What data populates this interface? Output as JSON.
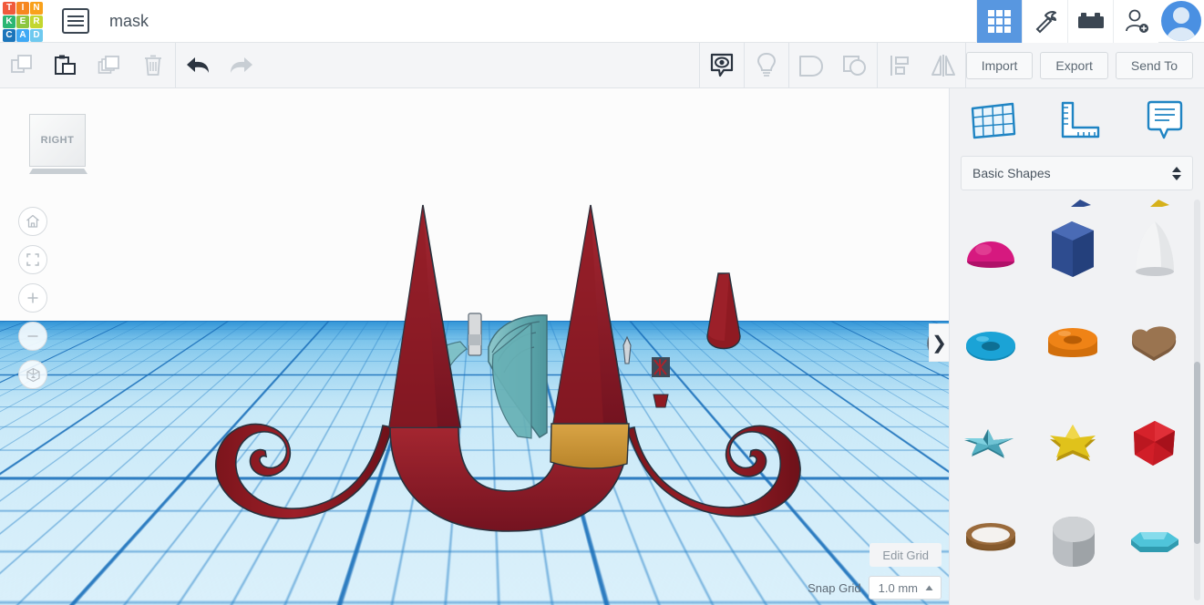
{
  "app": {
    "name": "Tinkercad",
    "logo_tiles": [
      {
        "letter": "T",
        "color": "#f05a3c"
      },
      {
        "letter": "I",
        "color": "#f6871f"
      },
      {
        "letter": "N",
        "color": "#f9a11b"
      },
      {
        "letter": "K",
        "color": "#2bb673"
      },
      {
        "letter": "E",
        "color": "#8dc63f"
      },
      {
        "letter": "R",
        "color": "#c3d62e"
      },
      {
        "letter": "C",
        "color": "#1b75bb"
      },
      {
        "letter": "A",
        "color": "#3fa9f5"
      },
      {
        "letter": "D",
        "color": "#6ec9ef"
      }
    ]
  },
  "header": {
    "menu_icon": "hamburger-list-icon",
    "document_title": "mask",
    "icons": [
      {
        "name": "grid-apps-icon",
        "label": "Designs",
        "active": true
      },
      {
        "name": "pickaxe-minecraft-icon",
        "label": "Minecraft",
        "active": false
      },
      {
        "name": "lego-brick-icon",
        "label": "Blocks",
        "active": false
      },
      {
        "name": "add-user-icon",
        "label": "Invite",
        "active": false
      }
    ],
    "avatar_label": "Account"
  },
  "toolbar": {
    "edit_tools": [
      {
        "name": "copy-icon",
        "label": "Copy",
        "enabled": false
      },
      {
        "name": "paste-icon",
        "label": "Paste",
        "enabled": true
      },
      {
        "name": "duplicate-icon",
        "label": "Duplicate",
        "enabled": false
      },
      {
        "name": "delete-trash-icon",
        "label": "Delete",
        "enabled": false
      }
    ],
    "history_tools": [
      {
        "name": "undo-icon",
        "label": "Undo",
        "enabled": true
      },
      {
        "name": "redo-icon",
        "label": "Redo",
        "enabled": false
      }
    ],
    "view_tools": [
      {
        "name": "show-hide-eye-icon",
        "label": "Show/Hide",
        "enabled": true
      },
      {
        "name": "lightbulb-icon",
        "label": "Light",
        "enabled": false
      }
    ],
    "group_tools": [
      {
        "name": "group-shapes-icon",
        "label": "Group",
        "enabled": false
      },
      {
        "name": "ungroup-shapes-icon",
        "label": "Ungroup",
        "enabled": false
      }
    ],
    "align_tools": [
      {
        "name": "align-icon",
        "label": "Align",
        "enabled": false
      },
      {
        "name": "mirror-flip-icon",
        "label": "Mirror",
        "enabled": false
      }
    ],
    "actions": [
      {
        "name": "import-button",
        "label": "Import"
      },
      {
        "name": "export-button",
        "label": "Export"
      },
      {
        "name": "send-to-button",
        "label": "Send To"
      }
    ]
  },
  "canvas": {
    "view_cube_label": "RIGHT",
    "nav_buttons": [
      {
        "name": "home-view-icon",
        "label": "Home view"
      },
      {
        "name": "fit-to-view-icon",
        "label": "Fit all in view"
      },
      {
        "name": "zoom-in-icon",
        "label": "Zoom in"
      },
      {
        "name": "zoom-out-icon",
        "label": "Zoom out"
      },
      {
        "name": "perspective-toggle-icon",
        "label": "Switch to orthographic view"
      }
    ],
    "edit_grid_label": "Edit Grid",
    "snap_grid_label": "Snap Grid",
    "snap_grid_value": "1.0 mm",
    "collapse_panel_glyph": "❯",
    "colors": {
      "workplane": "#7fc6ec",
      "grid_line": "#2882c8",
      "model_red": "#8f1a22",
      "model_teal": "#5fa8ad",
      "model_tan": "#c9922f"
    }
  },
  "panel": {
    "tabs": [
      {
        "name": "workplane-tab",
        "label": "Workplane",
        "icon": "workplane-grid-icon"
      },
      {
        "name": "ruler-tab",
        "label": "Ruler",
        "icon": "ruler-icon"
      },
      {
        "name": "notes-tab",
        "label": "Notes",
        "icon": "note-bubble-icon"
      }
    ],
    "shape_library": "Basic Shapes",
    "shapes": [
      {
        "name": "hemisphere-shape",
        "label": "Half Sphere",
        "color": "#d6197f"
      },
      {
        "name": "hexagonal-prism-shape",
        "label": "Hexagon Prism",
        "color": "#2e4c8f"
      },
      {
        "name": "paraboloid-shape",
        "label": "Paraboloid",
        "color": "#d6d8da"
      },
      {
        "name": "torus-shape",
        "label": "Torus",
        "color": "#1ba3d6"
      },
      {
        "name": "tube-shape",
        "label": "Tube",
        "color": "#ef8316"
      },
      {
        "name": "heart-shape",
        "label": "Heart",
        "color": "#9a7450"
      },
      {
        "name": "star-3d-shape",
        "label": "3D Star",
        "color": "#3c9fb5"
      },
      {
        "name": "star-flat-shape",
        "label": "Star",
        "color": "#e0c21b"
      },
      {
        "name": "polyhedron-shape",
        "label": "Polygon",
        "color": "#d61f2b"
      },
      {
        "name": "ring-shape",
        "label": "Ring",
        "color": "#9a6b3c"
      },
      {
        "name": "rounded-cube-shape",
        "label": "Round Roof",
        "color": "#b9bcbf"
      },
      {
        "name": "gem-octagon-shape",
        "label": "Diamond",
        "color": "#4fc4da"
      }
    ]
  }
}
